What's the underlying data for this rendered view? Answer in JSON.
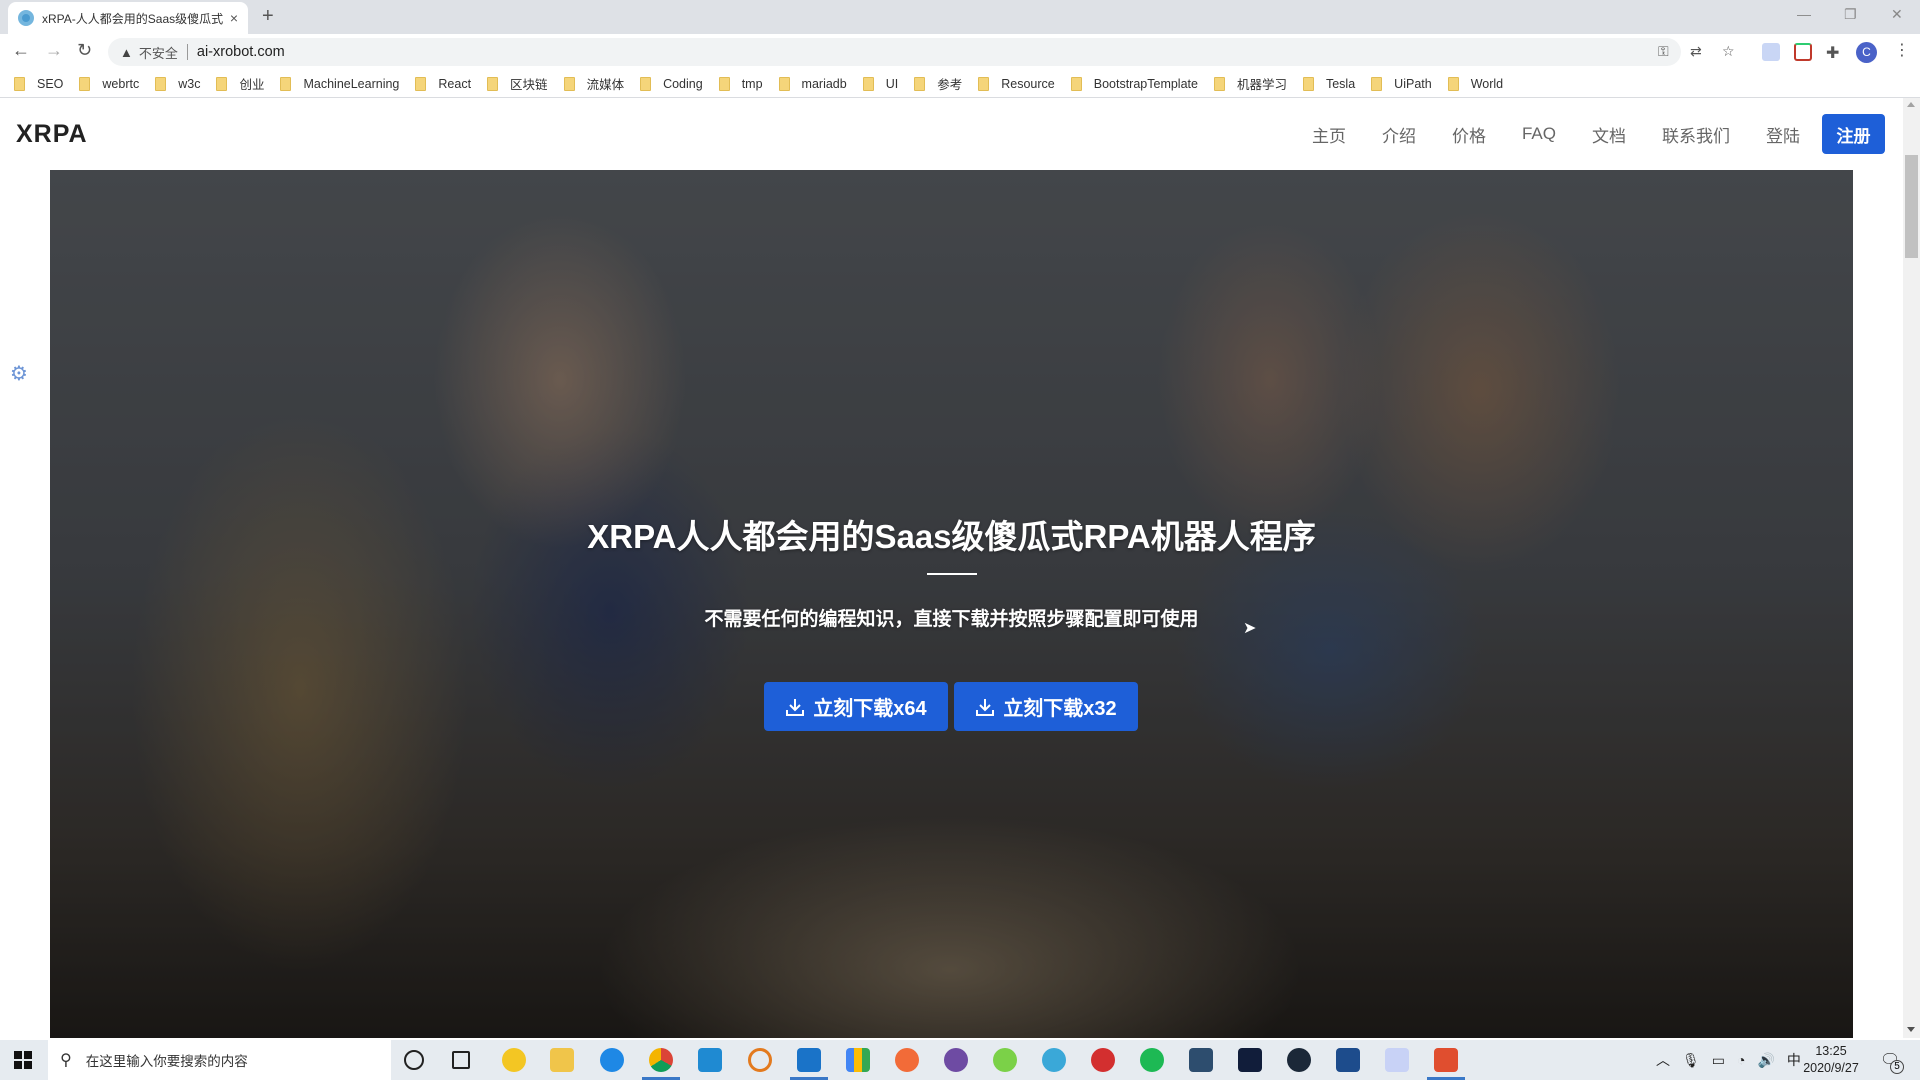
{
  "browser": {
    "tab_title": "xRPA-人人都会用的Saas级傻瓜式",
    "tab_close": "×",
    "new_tab": "+",
    "security_label": "不安全",
    "url": "ai-xrobot.com",
    "window_controls": {
      "minimize": "—",
      "restore": "❐",
      "close": "✕"
    },
    "profile_initial": "C",
    "bookmarks": [
      "SEO",
      "webrtc",
      "w3c",
      "创业",
      "MachineLearning",
      "React",
      "区块链",
      "流媒体",
      "Coding",
      "tmp",
      "mariadb",
      "UI",
      "参考",
      "Resource",
      "BootstrapTemplate",
      "机器学习",
      "Tesla",
      "UiPath",
      "World"
    ]
  },
  "site": {
    "logo": "XRPA",
    "nav": [
      "主页",
      "介绍",
      "价格",
      "FAQ",
      "文档",
      "联系我们",
      "登陆"
    ],
    "signup": "注册",
    "hero": {
      "title": "XRPA人人都会用的Saas级傻瓜式RPA机器人程序",
      "subtitle": "不需要任何的编程知识，直接下载并按照步骤配置即可使用",
      "download_x64": "立刻下载x64",
      "download_x32": "立刻下载x32"
    },
    "colors": {
      "primary": "#1e5fd8"
    }
  },
  "taskbar": {
    "search_placeholder": "在这里输入你要搜索的内容",
    "apps": [
      "cortana",
      "task-view",
      "qq-music",
      "file-explorer",
      "edge",
      "chrome",
      "vscode",
      "search-app",
      "teamviewer",
      "bookmark-app",
      "postman",
      "github-desktop",
      "wechat",
      "android-studio",
      "expressvpn",
      "spotify",
      "mysql-workbench",
      "visual-studio",
      "steam",
      "ds-app",
      "feishu",
      "camtasia"
    ],
    "tray": {
      "ime": "中",
      "time": "13:25",
      "date": "2020/9/27",
      "notifications": "5"
    }
  }
}
